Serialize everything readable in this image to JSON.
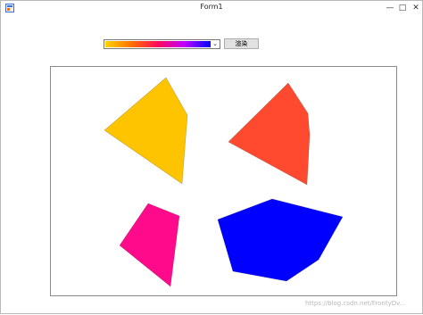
{
  "window": {
    "title": "Form1",
    "controls": {
      "minimize": "—",
      "maximize": "□",
      "close": "✕"
    }
  },
  "toolbar": {
    "color_combo": {
      "selected_gradient": [
        "#ffd400",
        "#ff6f00",
        "#ff0a5a",
        "#c000ff",
        "#0000ff"
      ],
      "arrow_glyph": "⌄"
    },
    "apply_label": "渲染"
  },
  "canvas": {
    "polygons": [
      {
        "name": "yellow-polygon",
        "color": "#ffc400"
      },
      {
        "name": "orange-red-polygon",
        "color": "#ff4a2f"
      },
      {
        "name": "magenta-polygon",
        "color": "#ff0a8a"
      },
      {
        "name": "blue-polygon",
        "color": "#0000ff"
      }
    ]
  },
  "watermark": "https://blog.csdn.net/FrontyDv..."
}
